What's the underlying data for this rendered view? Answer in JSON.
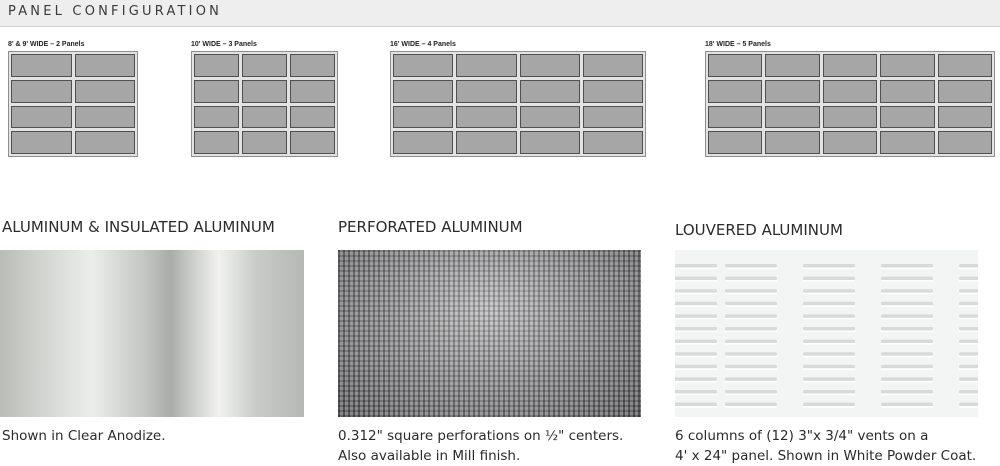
{
  "header": {
    "title": "PANEL CONFIGURATION"
  },
  "doors": [
    {
      "label": "8' & 9' WIDE – 2 Panels",
      "columns": 2,
      "rows": 4
    },
    {
      "label": "10' WIDE – 3 Panels",
      "columns": 3,
      "rows": 4
    },
    {
      "label": "16' WIDE – 4 Panels",
      "columns": 4,
      "rows": 4
    },
    {
      "label": "18' WIDE – 5 Panels",
      "columns": 5,
      "rows": 4
    }
  ],
  "finishes": [
    {
      "title": "ALUMINUM & INSULATED ALUMINUM",
      "caption_lines": [
        "Shown in Clear Anodize."
      ]
    },
    {
      "title": "PERFORATED ALUMINUM",
      "caption_lines": [
        "0.312\" square perforations on ½\" centers.",
        "Also available in Mill finish."
      ]
    },
    {
      "title": "LOUVERED ALUMINUM",
      "caption_lines": [
        "6 columns of (12) 3\"x 3/4\" vents on a",
        "4' x 24\" panel. Shown in White Powder Coat."
      ]
    }
  ],
  "colors": {
    "pane_fill": "#a6a6a7",
    "pane_border": "#505050",
    "header_band": "#eeeeee"
  }
}
